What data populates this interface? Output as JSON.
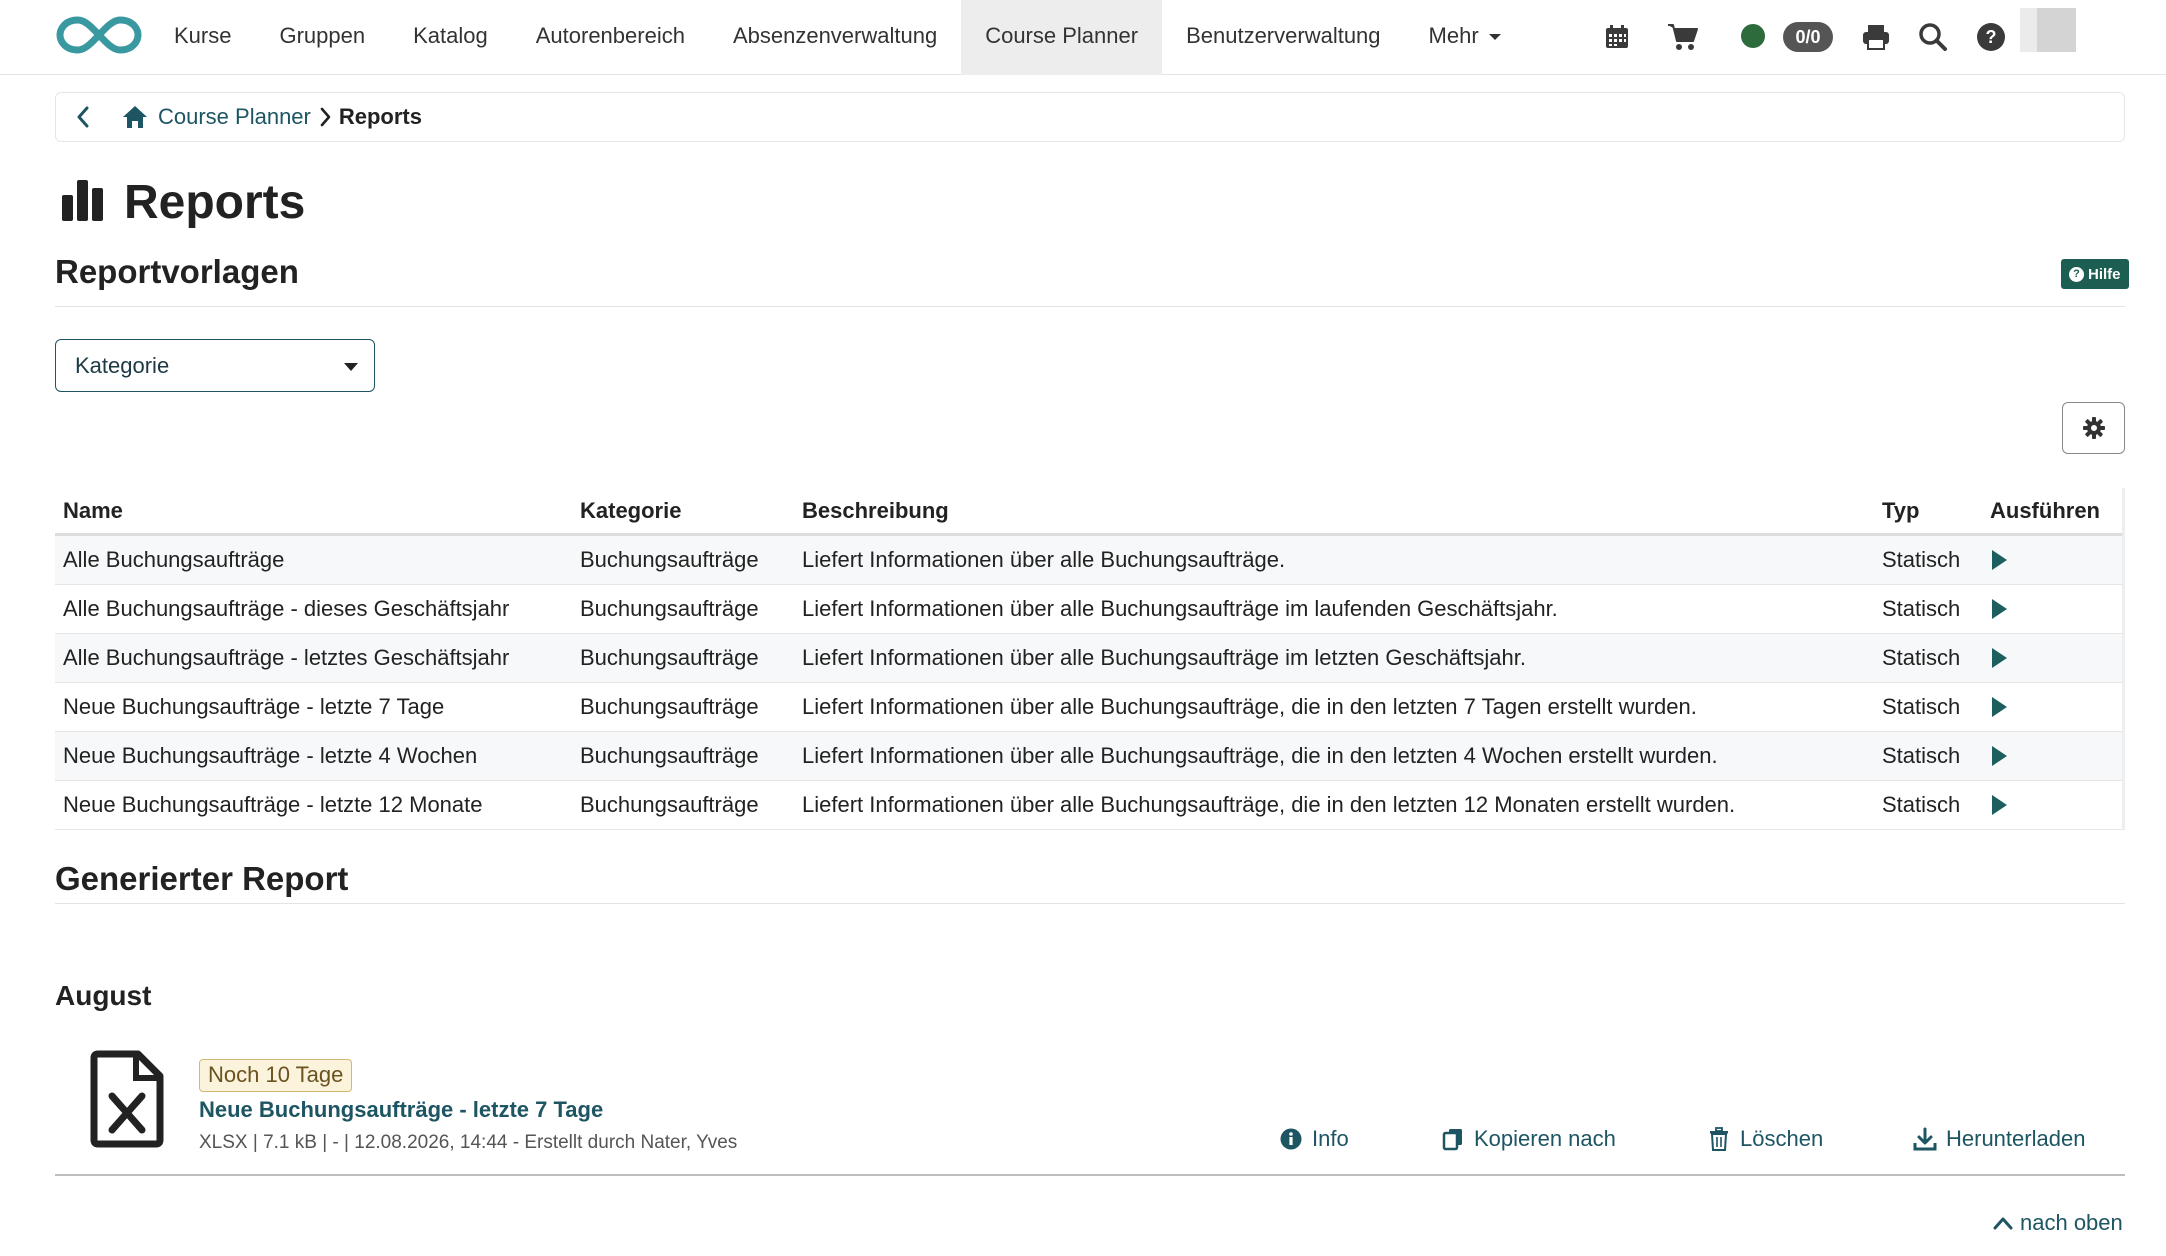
{
  "nav": {
    "items": [
      {
        "label": "Kurse",
        "name": "nav-kurse",
        "active": false
      },
      {
        "label": "Gruppen",
        "name": "nav-gruppen",
        "active": false
      },
      {
        "label": "Katalog",
        "name": "nav-katalog",
        "active": false
      },
      {
        "label": "Autorenbereich",
        "name": "nav-autorenbereich",
        "active": false
      },
      {
        "label": "Absenzenverwaltung",
        "name": "nav-absenzenverwaltung",
        "active": false
      },
      {
        "label": "Course Planner",
        "name": "nav-course-planner",
        "active": true
      },
      {
        "label": "Benutzerverwaltung",
        "name": "nav-benutzerverwaltung",
        "active": false
      }
    ],
    "more_label": "Mehr",
    "badge_count": "0/0",
    "accent_color": "#2a8a94"
  },
  "breadcrumb": {
    "parent": "Course Planner",
    "current": "Reports"
  },
  "page": {
    "title": "Reports",
    "templates_title": "Reportvorlagen",
    "help_label": "Hilfe",
    "filter_label": "Kategorie"
  },
  "table": {
    "headers": {
      "name": "Name",
      "category": "Kategorie",
      "description": "Beschreibung",
      "type": "Typ",
      "run": "Ausführen"
    },
    "rows": [
      {
        "name": "Alle Buchungsaufträge",
        "category": "Buchungsaufträge",
        "description": "Liefert Informationen über alle Buchungsaufträge.",
        "type": "Statisch"
      },
      {
        "name": "Alle Buchungsaufträge - dieses Geschäftsjahr",
        "category": "Buchungsaufträge",
        "description": "Liefert Informationen über alle Buchungsaufträge im laufenden Geschäftsjahr.",
        "type": "Statisch"
      },
      {
        "name": "Alle Buchungsaufträge - letztes Geschäftsjahr",
        "category": "Buchungsaufträge",
        "description": "Liefert Informationen über alle Buchungsaufträge im letzten Geschäftsjahr.",
        "type": "Statisch"
      },
      {
        "name": "Neue Buchungsaufträge - letzte 7 Tage",
        "category": "Buchungsaufträge",
        "description": "Liefert Informationen über alle Buchungsaufträge, die in den letzten 7 Tagen erstellt wurden.",
        "type": "Statisch"
      },
      {
        "name": "Neue Buchungsaufträge - letzte 4 Wochen",
        "category": "Buchungsaufträge",
        "description": "Liefert Informationen über alle Buchungsaufträge, die in den letzten 4 Wochen erstellt wurden.",
        "type": "Statisch"
      },
      {
        "name": "Neue Buchungsaufträge - letzte 12 Monate",
        "category": "Buchungsaufträge",
        "description": "Liefert Informationen über alle Buchungsaufträge, die in den letzten 12 Monaten erstellt wurden.",
        "type": "Statisch"
      }
    ]
  },
  "generated": {
    "title": "Generierter Report",
    "month": "August",
    "report": {
      "expires": "Noch 10 Tage",
      "name": "Neue Buchungsaufträge - letzte 7 Tage",
      "meta": "XLSX | 7.1 kB | - | 12.08.2026, 14:44 - Erstellt durch Nater, Yves"
    },
    "actions": {
      "info": "Info",
      "copy": "Kopieren nach",
      "delete": "Löschen",
      "download": "Herunterladen"
    }
  },
  "footer": {
    "to_top": "nach oben"
  }
}
